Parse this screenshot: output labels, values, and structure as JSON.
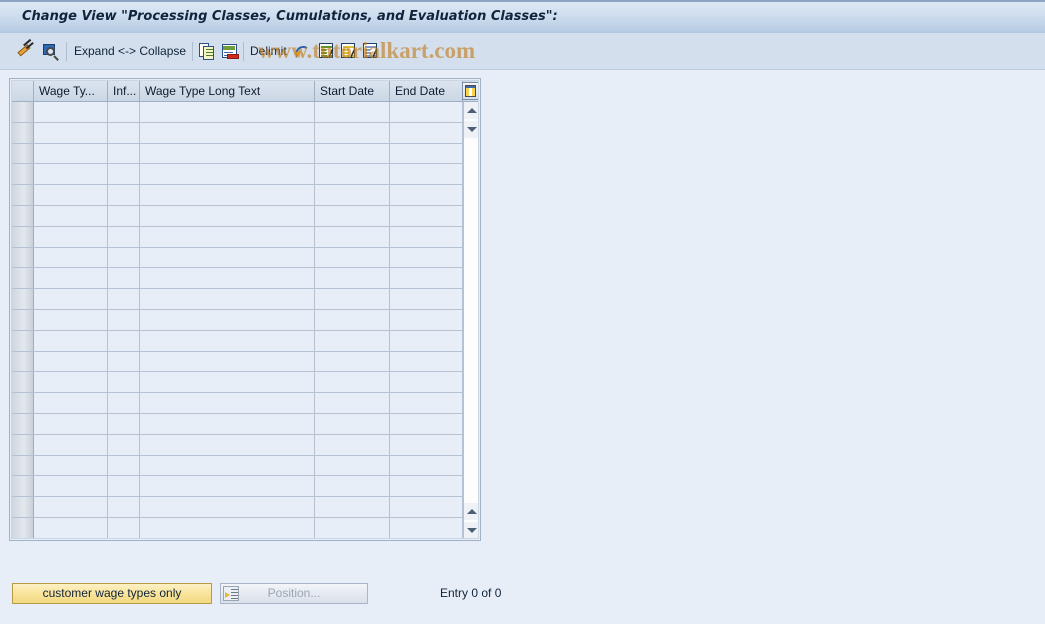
{
  "window": {
    "title": "Change View \"Processing Classes, Cumulations, and Evaluation Classes\":"
  },
  "watermark": {
    "text": "www.tutorialkart.com"
  },
  "toolbar": {
    "items": [
      {
        "name": "change-entry-button",
        "icon": "pencil-icon",
        "label": ""
      },
      {
        "name": "display-entry-button",
        "icon": "magnifier-icon",
        "label": ""
      },
      {
        "name": "expand-collapse-button",
        "icon": "",
        "label": "Expand <-> Collapse"
      },
      {
        "name": "copy-as-button",
        "icon": "copy-icon",
        "label": ""
      },
      {
        "name": "delete-button",
        "icon": "delete-row-icon",
        "label": ""
      },
      {
        "name": "delimit-button",
        "icon": "",
        "label": "Delimit"
      },
      {
        "name": "undo-change-button",
        "icon": "undo-icon",
        "label": ""
      },
      {
        "name": "previous-entry-button",
        "icon": "page-green-icon",
        "label": ""
      },
      {
        "name": "next-entry-button",
        "icon": "page-yellow-icon",
        "label": ""
      },
      {
        "name": "other-entry-button",
        "icon": "page-blue-icon",
        "label": ""
      }
    ]
  },
  "table": {
    "columns": [
      {
        "name": "row-selector-column",
        "label": ""
      },
      {
        "name": "wage-type-column",
        "label": "Wage Ty..."
      },
      {
        "name": "infotype-column",
        "label": "Inf..."
      },
      {
        "name": "wage-type-long-text-column",
        "label": "Wage Type Long Text"
      },
      {
        "name": "start-date-column",
        "label": "Start Date"
      },
      {
        "name": "end-date-column",
        "label": "End Date"
      }
    ],
    "config_icon": "table-settings-icon",
    "rows": [],
    "row_count": 21
  },
  "footer": {
    "customer_wage_types_label": "customer wage types only",
    "position_label": "Position...",
    "position_icon": "position-icon",
    "entry_count": "Entry 0 of 0"
  },
  "colors": {
    "title_gradient_top": "#dde8f4",
    "title_gradient_bottom": "#aec6e0",
    "toolbar_bg": "#d3dfec",
    "page_bg": "#e8eef7",
    "header_bg": "#cfd9e6",
    "grid_line": "#b4c2d4",
    "accent_yellow": "#f9e49a",
    "watermark": "#c47a16"
  }
}
